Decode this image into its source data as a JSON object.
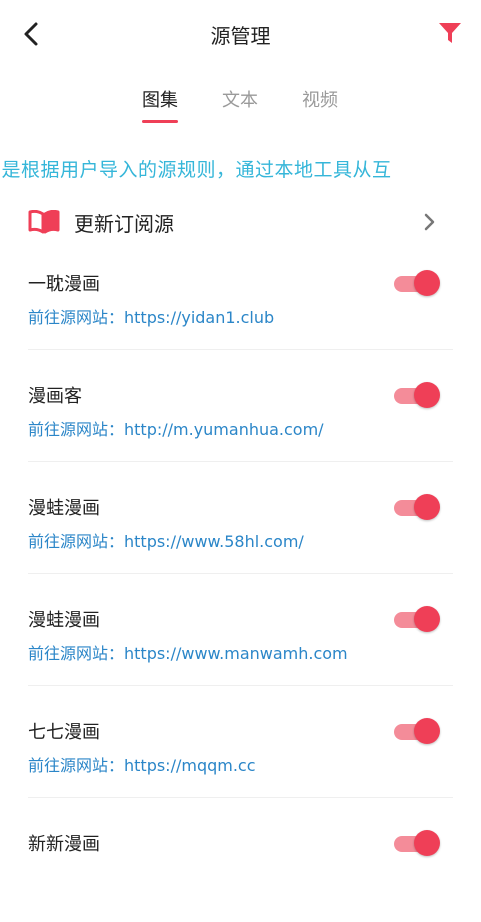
{
  "header": {
    "title": "源管理"
  },
  "tabs": [
    {
      "label": "图集",
      "active": true
    },
    {
      "label": "文本",
      "active": false
    },
    {
      "label": "视频",
      "active": false
    }
  ],
  "notice": {
    "text": "的是根据用户导入的源规则，通过本地工具从互"
  },
  "subscribe": {
    "label": "更新订阅源"
  },
  "sources": [
    {
      "name": "一耽漫画",
      "link": "前往源网站：https://yidan1.club",
      "enabled": true
    },
    {
      "name": "漫画客",
      "link": "前往源网站：http://m.yumanhua.com/",
      "enabled": true
    },
    {
      "name": "漫蛙漫画",
      "link": "前往源网站：https://www.58hl.com/",
      "enabled": true
    },
    {
      "name": "漫蛙漫画",
      "link": "前往源网站：https://www.manwamh.com",
      "enabled": true
    },
    {
      "name": "七七漫画",
      "link": "前往源网站：https://mqqm.cc",
      "enabled": true
    },
    {
      "name": "新新漫画",
      "link": "",
      "enabled": true
    }
  ],
  "colors": {
    "accent": "#ef3f57",
    "accent_light": "#f48c99",
    "link": "#2b86c8",
    "notice": "#35b6d9"
  },
  "icons": {
    "back": "chevron-left-icon",
    "filter": "filter-icon",
    "subscribe": "book-icon",
    "more": "chevron-right-icon"
  }
}
